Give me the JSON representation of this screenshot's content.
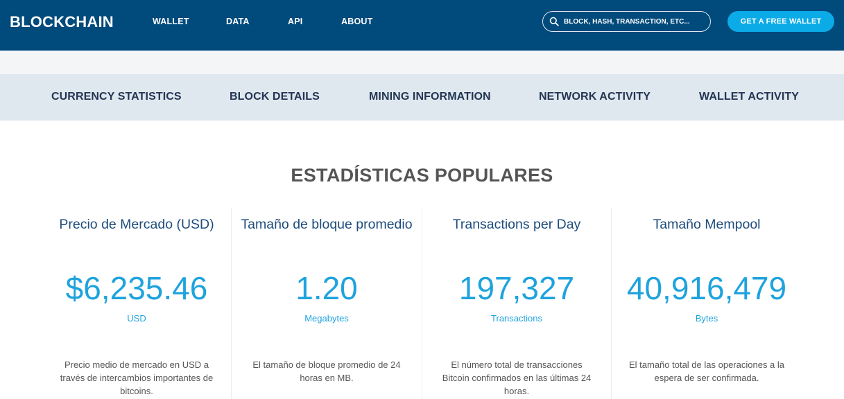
{
  "header": {
    "logo": "BLOCKCHAIN",
    "nav": [
      "WALLET",
      "DATA",
      "API",
      "ABOUT"
    ],
    "search_placeholder": "BLOCK, HASH, TRANSACTION, ETC...",
    "cta_label": "GET A FREE WALLET"
  },
  "subnav": [
    "CURRENCY STATISTICS",
    "BLOCK DETAILS",
    "MINING INFORMATION",
    "NETWORK ACTIVITY",
    "WALLET ACTIVITY"
  ],
  "section_title": "ESTADÍSTICAS POPULARES",
  "stats": [
    {
      "title": "Precio de Mercado (USD)",
      "value": "$6,235.46",
      "unit": "USD",
      "description": "Precio medio de mercado en USD a través de intercambios importantes de bitcoins."
    },
    {
      "title": "Tamaño de bloque promedio",
      "value": "1.20",
      "unit": "Megabytes",
      "description": "El tamaño de bloque promedio de 24 horas en MB."
    },
    {
      "title": "Transactions per Day",
      "value": "197,327",
      "unit": "Transactions",
      "description": "El número total de transacciones Bitcoin confirmados en las últimas 24 horas."
    },
    {
      "title": "Tamaño Mempool",
      "value": "40,916,479",
      "unit": "Bytes",
      "description": "El tamaño total de las operaciones a la espera de ser confirmada."
    }
  ],
  "colors": {
    "header_bg": "#004a7c",
    "cta_bg": "#0aabe7",
    "subnav_bg": "#dfe8ef",
    "accent_value": "#1ea3dd",
    "stat_title": "#1d4c7c"
  },
  "icons": {
    "search": "search-icon"
  }
}
